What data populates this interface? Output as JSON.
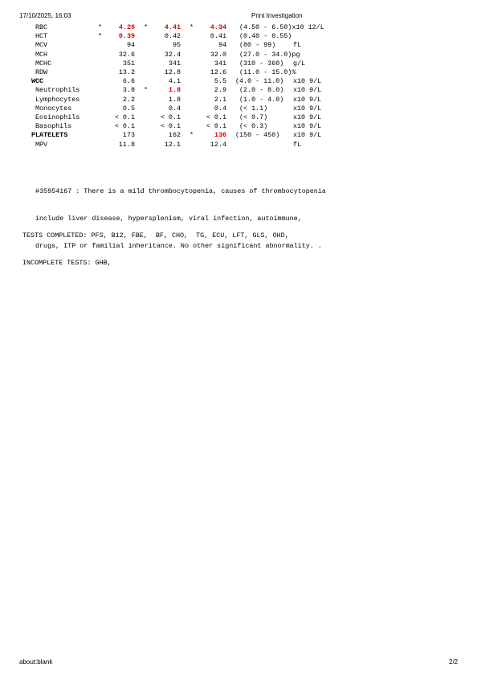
{
  "header": {
    "datetime": "17/10/2025, 16:03",
    "title": "Print Investigation"
  },
  "results": [
    {
      "name": "RBC",
      "indent": 1,
      "bold": false,
      "c1": {
        "flag": "*",
        "value": "4.20",
        "abnormal": true
      },
      "c2": {
        "flag": "*",
        "value": "4.41",
        "abnormal": true
      },
      "c3": {
        "flag": "*",
        "value": "4.34",
        "abnormal": true
      },
      "range": "(4.50 - 6.50)",
      "unit": "x10 12/L"
    },
    {
      "name": "HCT",
      "indent": 1,
      "bold": false,
      "c1": {
        "flag": "*",
        "value": "0.39",
        "abnormal": true
      },
      "c2": {
        "flag": "",
        "value": "0.42",
        "abnormal": false
      },
      "c3": {
        "flag": "",
        "value": "0.41",
        "abnormal": false
      },
      "range": "(0.40 - 0.55)",
      "unit": ""
    },
    {
      "name": "MCV",
      "indent": 1,
      "bold": false,
      "c1": {
        "flag": "",
        "value": "94",
        "abnormal": false
      },
      "c2": {
        "flag": "",
        "value": "95",
        "abnormal": false
      },
      "c3": {
        "flag": "",
        "value": "94",
        "abnormal": false
      },
      "range": "(80 - 99)",
      "unit": "fL"
    },
    {
      "name": "MCH",
      "indent": 1,
      "bold": false,
      "c1": {
        "flag": "",
        "value": "32.6",
        "abnormal": false
      },
      "c2": {
        "flag": "",
        "value": "32.4",
        "abnormal": false
      },
      "c3": {
        "flag": "",
        "value": "32.0",
        "abnormal": false
      },
      "range": "(27.0 - 34.0)",
      "unit": "pg"
    },
    {
      "name": "MCHC",
      "indent": 1,
      "bold": false,
      "c1": {
        "flag": "",
        "value": "351",
        "abnormal": false
      },
      "c2": {
        "flag": "",
        "value": "341",
        "abnormal": false
      },
      "c3": {
        "flag": "",
        "value": "341",
        "abnormal": false
      },
      "range": "(310 - 360)",
      "unit": "g/L"
    },
    {
      "name": "RDW",
      "indent": 1,
      "bold": false,
      "c1": {
        "flag": "",
        "value": "13.2",
        "abnormal": false
      },
      "c2": {
        "flag": "",
        "value": "12.8",
        "abnormal": false
      },
      "c3": {
        "flag": "",
        "value": "12.6",
        "abnormal": false
      },
      "range": "(11.0 - 15.0)",
      "unit": "%"
    },
    {
      "name": "WCC",
      "indent": 0,
      "bold": true,
      "c1": {
        "flag": "",
        "value": "6.6",
        "abnormal": false
      },
      "c2": {
        "flag": "",
        "value": "4.1",
        "abnormal": false
      },
      "c3": {
        "flag": "",
        "value": "5.5",
        "abnormal": false
      },
      "range": "(4.0 - 11.0)",
      "unit": "x10 9/L"
    },
    {
      "name": "Neutrophils",
      "indent": 1,
      "bold": false,
      "c1": {
        "flag": "",
        "value": "3.8",
        "abnormal": false
      },
      "c2": {
        "flag": "*",
        "value": "1.8",
        "abnormal": true
      },
      "c3": {
        "flag": "",
        "value": "2.9",
        "abnormal": false
      },
      "range": "(2.0 - 8.0)",
      "unit": "x10 9/L"
    },
    {
      "name": "Lymphocytes",
      "indent": 1,
      "bold": false,
      "c1": {
        "flag": "",
        "value": "2.2",
        "abnormal": false
      },
      "c2": {
        "flag": "",
        "value": "1.8",
        "abnormal": false
      },
      "c3": {
        "flag": "",
        "value": "2.1",
        "abnormal": false
      },
      "range": "(1.0 - 4.0)",
      "unit": "x10 9/L"
    },
    {
      "name": "Monocytes",
      "indent": 1,
      "bold": false,
      "c1": {
        "flag": "",
        "value": "0.5",
        "abnormal": false
      },
      "c2": {
        "flag": "",
        "value": "0.4",
        "abnormal": false
      },
      "c3": {
        "flag": "",
        "value": "0.4",
        "abnormal": false
      },
      "range": "(< 1.1)",
      "unit": "x10 9/L"
    },
    {
      "name": "Eosinophils",
      "indent": 1,
      "bold": false,
      "c1": {
        "flag": "",
        "value": "< 0.1",
        "abnormal": false
      },
      "c2": {
        "flag": "",
        "value": "< 0.1",
        "abnormal": false
      },
      "c3": {
        "flag": "",
        "value": "< 0.1",
        "abnormal": false
      },
      "range": "(< 0.7)",
      "unit": "x10 9/L"
    },
    {
      "name": "Basophils",
      "indent": 1,
      "bold": false,
      "c1": {
        "flag": "",
        "value": "< 0.1",
        "abnormal": false
      },
      "c2": {
        "flag": "",
        "value": "< 0.1",
        "abnormal": false
      },
      "c3": {
        "flag": "",
        "value": "< 0.1",
        "abnormal": false
      },
      "range": "(< 0.3)",
      "unit": "x10 9/L"
    },
    {
      "name": "PLATELETS",
      "indent": 0,
      "bold": true,
      "c1": {
        "flag": "",
        "value": "173",
        "abnormal": false
      },
      "c2": {
        "flag": "",
        "value": "162",
        "abnormal": false
      },
      "c3": {
        "flag": "*",
        "value": "136",
        "abnormal": true
      },
      "range": "(150 - 450)",
      "unit": "x10 9/L"
    },
    {
      "name": "MPV",
      "indent": 1,
      "bold": false,
      "c1": {
        "flag": "",
        "value": "11.8",
        "abnormal": false
      },
      "c2": {
        "flag": "",
        "value": "12.1",
        "abnormal": false
      },
      "c3": {
        "flag": "",
        "value": "12.4",
        "abnormal": false
      },
      "range": "",
      "unit": "fL"
    }
  ],
  "comment": {
    "lines": [
      "#35954167 : There is a mild thrombocytopenia, causes of thrombocytopenia",
      "include liver disease, hypersplenism, viral infection, autoimmune,",
      "drugs, ITP or familial inheritance. No other significant abnormality. ."
    ]
  },
  "tests": {
    "completed": "TESTS COMPLETED: PFS, B12, FBE,  BF, CHO,  TG, ECU, LFT, GLS, OHD,",
    "incomplete": "INCOMPLETE TESTS: GHB,"
  },
  "footer": {
    "url": "about:blank",
    "page": "2/2"
  }
}
